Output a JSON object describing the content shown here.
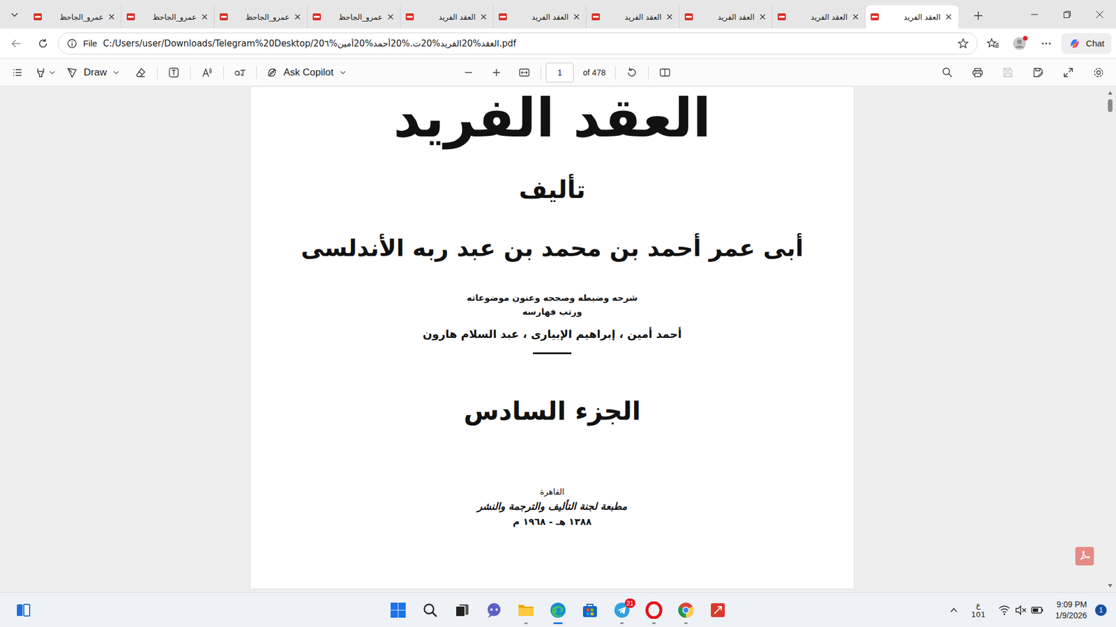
{
  "tabs": [
    {
      "label": "عمرو_الجاحظ",
      "selected": false
    },
    {
      "label": "عمرو_الجاحظ",
      "selected": false
    },
    {
      "label": "عمرو_الجاحظ",
      "selected": false
    },
    {
      "label": "عمرو_الجاحظ",
      "selected": false
    },
    {
      "label": "العقد الفريد",
      "selected": false
    },
    {
      "label": "العقد الفريد",
      "selected": false
    },
    {
      "label": "العقد الفريد",
      "selected": false
    },
    {
      "label": "العقد الفريد",
      "selected": false
    },
    {
      "label": "العقد الفريد",
      "selected": false
    },
    {
      "label": "العقد الفريد",
      "selected": true
    }
  ],
  "address_bar": {
    "scheme": "File",
    "url": "C:/Users/user/Downloads/Telegram%20Desktop/العقد%20الفريد%20ت.%20أحمد%20أمين%20٦.pdf"
  },
  "profile": {
    "notification_dot": true
  },
  "copilot_button": {
    "label": "Chat"
  },
  "pdf_toolbar": {
    "draw_label": "Draw",
    "ask_label": "Ask Copilot",
    "page": "1",
    "page_count": "of 478",
    "save_enabled": false
  },
  "document": {
    "title": "العقد الفريد",
    "by": "تأليف",
    "author": "أبى عمر أحمد بن محمد بن عبد ربه الأندلسى",
    "credits": [
      "شرحه وضبطه وصححه وعنون موضوعاته",
      "ورتب فهارسه"
    ],
    "editors": "أحمد أمين ، إبراهيم الإبيارى ، عبد السلام هارون",
    "volume": "الجزء السادس",
    "city": "القاهرة",
    "publisher": "مطبعة لجنة التأليف والترجمة والنشر",
    "date": "١٣٨٨ هـ - ١٩٦٨ م"
  },
  "taskbar": {
    "apps": [
      {
        "kind": "start",
        "running": false,
        "active": false
      },
      {
        "kind": "search",
        "running": false,
        "active": false
      },
      {
        "kind": "taskview",
        "running": false,
        "active": false
      },
      {
        "kind": "chat",
        "running": false,
        "active": false
      },
      {
        "kind": "explorer",
        "running": true,
        "active": false
      },
      {
        "kind": "edge",
        "running": true,
        "active": true
      },
      {
        "kind": "store",
        "running": false,
        "active": false
      },
      {
        "kind": "telegram",
        "running": true,
        "active": false,
        "badge": "21"
      },
      {
        "kind": "opera",
        "running": true,
        "active": false
      },
      {
        "kind": "chrome",
        "running": true,
        "active": false
      },
      {
        "kind": "snip",
        "running": false,
        "active": false
      }
    ],
    "tray": {
      "language": "ع",
      "layout": "101",
      "time": "9:09 PM",
      "date": "1/9/2026",
      "notifications": "1"
    }
  }
}
